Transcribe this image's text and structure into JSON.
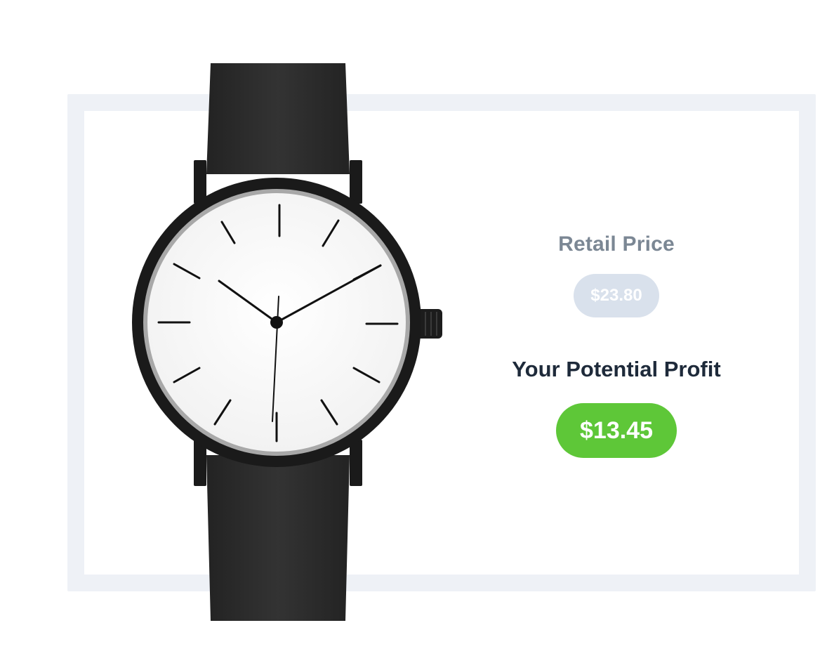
{
  "retail": {
    "label": "Retail Price",
    "price": "$23.80"
  },
  "profit": {
    "label": "Your Potential Profit",
    "amount": "$13.45"
  },
  "colors": {
    "frame": "#eef1f6",
    "retail_label": "#7b8794",
    "retail_pill": "#d9e1ec",
    "profit_label": "#1e2a3a",
    "profit_pill": "#5ec738",
    "watch_strap": "#2b2b2b",
    "watch_case": "#1a1a1a",
    "watch_dial": "#ffffff"
  },
  "image": {
    "icon": "wristwatch-product-image"
  }
}
